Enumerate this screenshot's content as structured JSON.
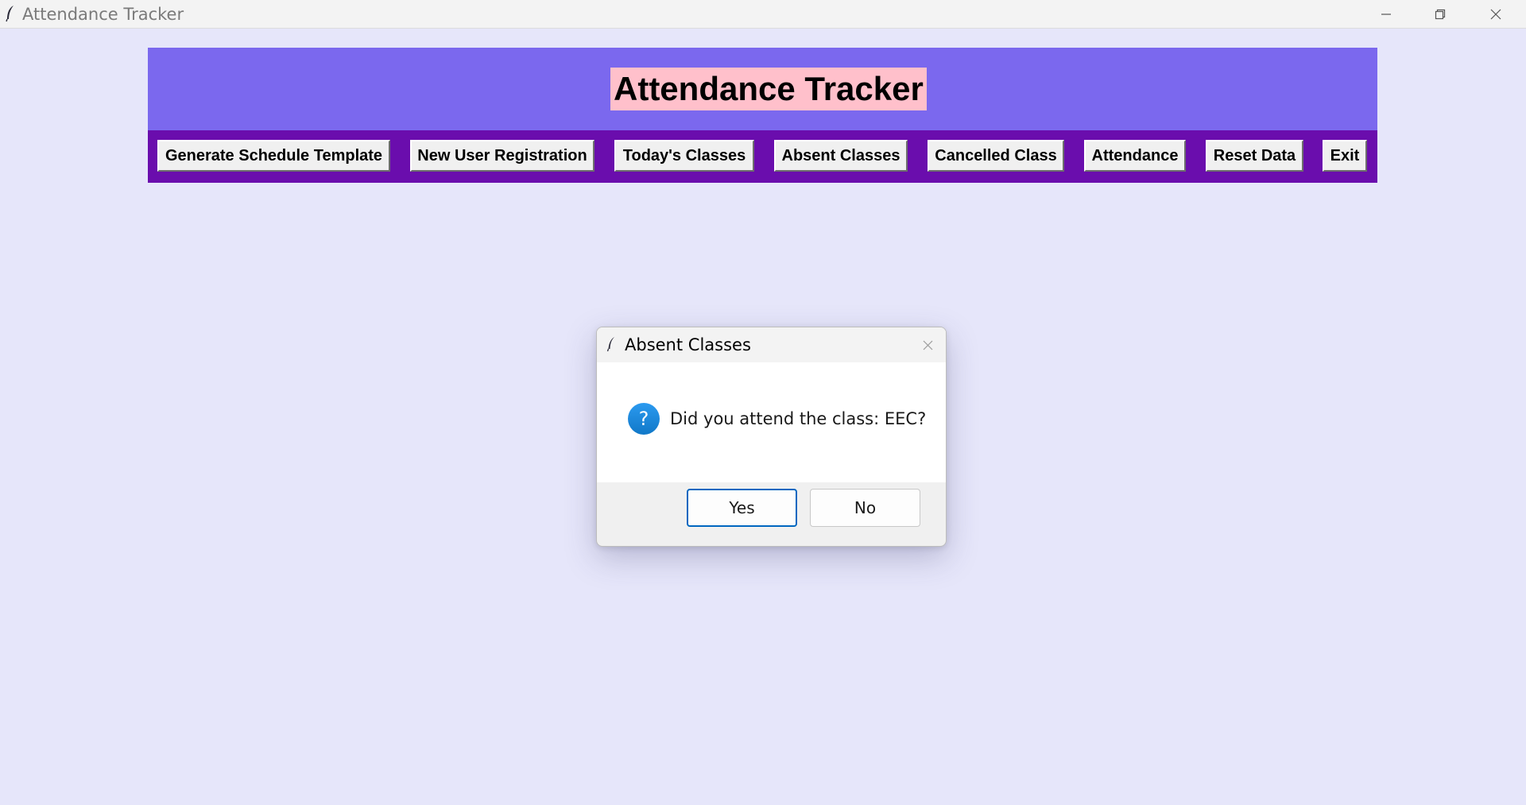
{
  "window": {
    "title": "Attendance Tracker",
    "controls": [
      "minimize-icon",
      "restore-icon",
      "close-icon"
    ]
  },
  "app": {
    "heading": "Attendance Tracker",
    "colors": {
      "background": "#e6e6fa",
      "banner": "#7b68ee",
      "heading_highlight": "#ffc0cb",
      "nav_bar": "#6a0dad"
    },
    "nav": [
      {
        "label": "Generate Schedule Template"
      },
      {
        "label": "New User Registration"
      },
      {
        "label": "Today's Classes"
      },
      {
        "label": "Absent Classes"
      },
      {
        "label": "Cancelled Class"
      },
      {
        "label": "Attendance"
      },
      {
        "label": "Reset Data"
      },
      {
        "label": "Exit"
      }
    ]
  },
  "dialog": {
    "title": "Absent Classes",
    "icon": "question-icon",
    "message": "Did you attend the class: EEC?",
    "buttons": {
      "yes": "Yes",
      "no": "No"
    },
    "default_button": "yes",
    "colors": {
      "question_icon": "#1c8adb",
      "focus_border": "#0067c0"
    }
  }
}
